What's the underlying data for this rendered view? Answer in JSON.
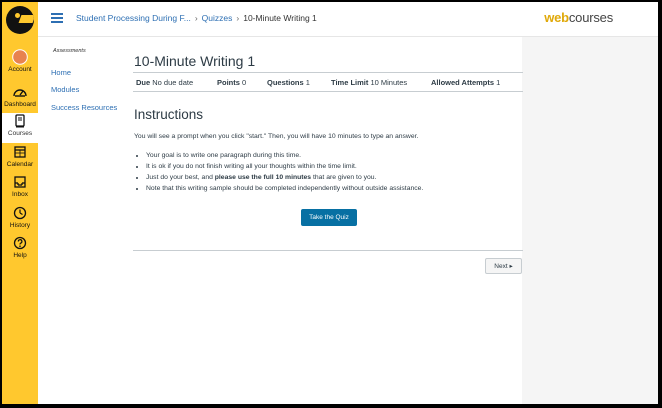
{
  "global_nav": {
    "items": [
      {
        "label": "Account",
        "icon": "account-avatar-icon"
      },
      {
        "label": "Dashboard",
        "icon": "dashboard-gauge-icon"
      },
      {
        "label": "Courses",
        "icon": "courses-book-icon"
      },
      {
        "label": "Calendar",
        "icon": "calendar-icon"
      },
      {
        "label": "Inbox",
        "icon": "inbox-icon"
      },
      {
        "label": "History",
        "icon": "history-clock-icon"
      },
      {
        "label": "Help",
        "icon": "help-question-icon"
      }
    ],
    "active": "Courses",
    "color": "#ffc82e"
  },
  "header": {
    "breadcrumbs": [
      "Student Processing During F...",
      "Quizzes",
      "10-Minute Writing 1"
    ],
    "brand_web": "web",
    "brand_courses": "courses"
  },
  "course_nav": {
    "subtitle": "Assessments",
    "links": [
      "Home",
      "Modules",
      "Success Resources"
    ]
  },
  "quiz": {
    "title": "10-Minute Writing 1",
    "details": {
      "due_label": "Due",
      "due_value": "No due date",
      "points_label": "Points",
      "points_value": "0",
      "questions_label": "Questions",
      "questions_value": "1",
      "time_limit_label": "Time Limit",
      "time_limit_value": "10 Minutes",
      "attempts_label": "Allowed Attempts",
      "attempts_value": "1"
    },
    "instructions_heading": "Instructions",
    "intro": "You will see a prompt when you click \"start.\" Then, you will have 10 minutes to type an answer.",
    "bullets": [
      "Your goal is to write one paragraph during this time.",
      "It is ok if you do not finish writing all your thoughts within the time limit.",
      "Note that this writing sample should be completed independently without outside assistance."
    ],
    "bullet3_pre": "Just do your best, and ",
    "bullet3_bold": "please use the full 10 minutes",
    "bullet3_post": " that are given to you.",
    "take_quiz_label": "Take the Quiz",
    "next_label": "Next ▸"
  },
  "colors": {
    "accent": "#0770a3",
    "link": "#2d6fb3",
    "brand_gold": "#e0a90a"
  }
}
